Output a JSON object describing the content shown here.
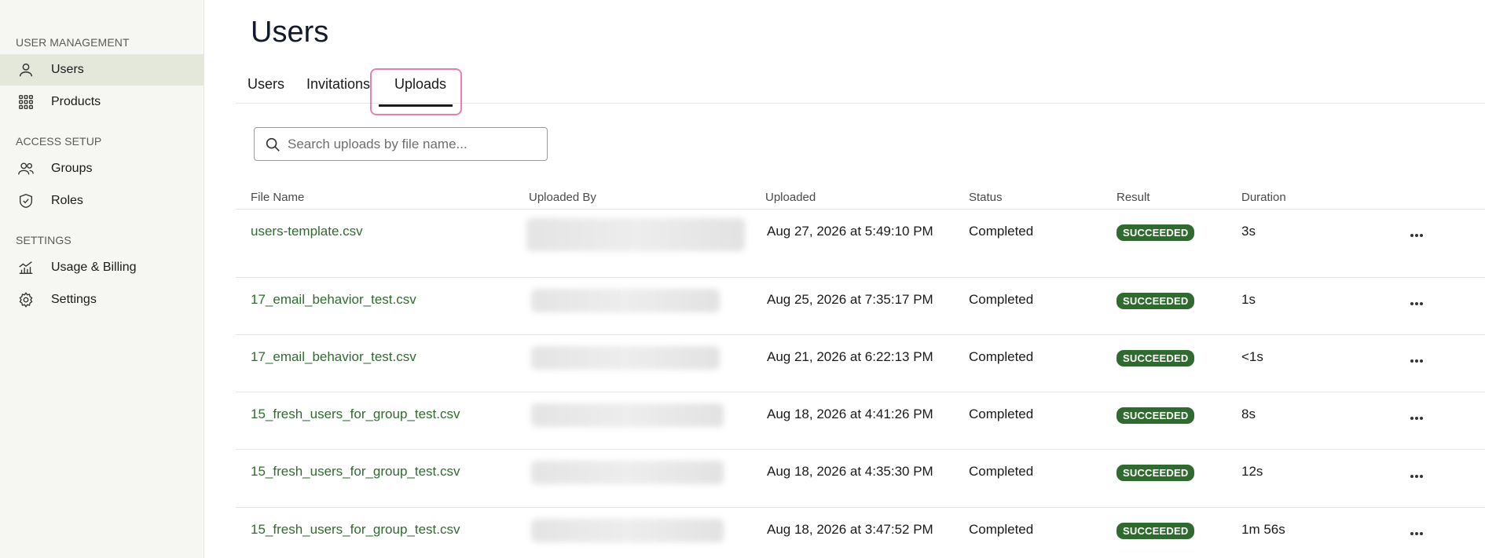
{
  "sidebar": {
    "sections": [
      {
        "label": "USER MANAGEMENT",
        "items": [
          {
            "label": "Users",
            "icon": "user-icon",
            "active": true
          },
          {
            "label": "Products",
            "icon": "grid-icon",
            "active": false
          }
        ]
      },
      {
        "label": "ACCESS SETUP",
        "items": [
          {
            "label": "Groups",
            "icon": "users-icon",
            "active": false
          },
          {
            "label": "Roles",
            "icon": "shield-icon",
            "active": false
          }
        ]
      },
      {
        "label": "SETTINGS",
        "items": [
          {
            "label": "Usage & Billing",
            "icon": "chart-icon",
            "active": false
          },
          {
            "label": "Settings",
            "icon": "gear-icon",
            "active": false
          }
        ]
      }
    ]
  },
  "page": {
    "title": "Users"
  },
  "tabs": [
    {
      "label": "Users",
      "selected": false
    },
    {
      "label": "Invitations",
      "selected": false
    },
    {
      "label": "Uploads",
      "selected": true
    }
  ],
  "search": {
    "placeholder": "Search uploads by file name..."
  },
  "table": {
    "headers": [
      "File Name",
      "Uploaded By",
      "Uploaded",
      "Status",
      "Result",
      "Duration"
    ],
    "rows": [
      {
        "file": "users-template.csv",
        "uploaded": "Aug 27, 2026 at 5:49:10 PM",
        "status": "Completed",
        "result": "SUCCEEDED",
        "duration": "3s"
      },
      {
        "file": "17_email_behavior_test.csv",
        "uploaded": "Aug 25, 2026 at 7:35:17 PM",
        "status": "Completed",
        "result": "SUCCEEDED",
        "duration": "1s"
      },
      {
        "file": "17_email_behavior_test.csv",
        "uploaded": "Aug 21, 2026 at 6:22:13 PM",
        "status": "Completed",
        "result": "SUCCEEDED",
        "duration": "<1s"
      },
      {
        "file": "15_fresh_users_for_group_test.csv",
        "uploaded": "Aug 18, 2026 at 4:41:26 PM",
        "status": "Completed",
        "result": "SUCCEEDED",
        "duration": "8s"
      },
      {
        "file": "15_fresh_users_for_group_test.csv",
        "uploaded": "Aug 18, 2026 at 4:35:30 PM",
        "status": "Completed",
        "result": "SUCCEEDED",
        "duration": "12s"
      },
      {
        "file": "15_fresh_users_for_group_test.csv",
        "uploaded": "Aug 18, 2026 at 3:47:52 PM",
        "status": "Completed",
        "result": "SUCCEEDED",
        "duration": "1m 56s"
      }
    ]
  },
  "colors": {
    "accent": "#2f6b2f",
    "sidebar_active": "#e3e8da",
    "tab_highlight": "#e87fb0"
  }
}
